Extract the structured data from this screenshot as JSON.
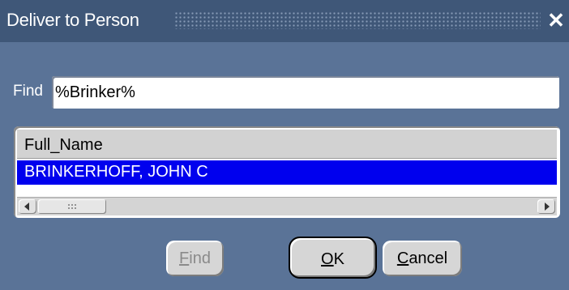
{
  "window": {
    "title": "Deliver to Person",
    "close_glyph": "✕"
  },
  "find": {
    "label": "Find",
    "value": "%Brinker%"
  },
  "list": {
    "column_header": "Full_Name",
    "rows": [
      {
        "full_name": "BRINKERHOFF, JOHN C",
        "selected": true
      }
    ]
  },
  "buttons": {
    "find": {
      "mnemonic": "F",
      "rest": "ind",
      "enabled": false
    },
    "ok": {
      "mnemonic": "O",
      "rest": "K"
    },
    "cancel": {
      "mnemonic": "C",
      "rest": "ancel"
    }
  },
  "colors": {
    "background": "#5a7397",
    "titlebar": "#3f5778",
    "selection": "#0000ee"
  }
}
